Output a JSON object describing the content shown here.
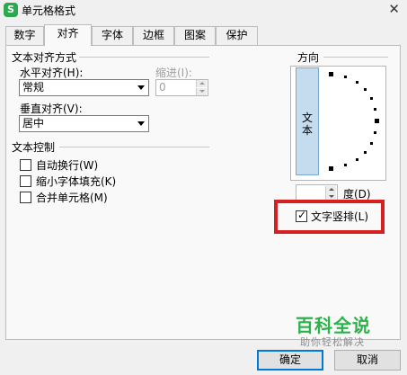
{
  "window": {
    "title": "单元格格式",
    "app_icon": "S",
    "close_label": "✕"
  },
  "tabs": [
    {
      "label": "数字"
    },
    {
      "label": "对齐",
      "active": true
    },
    {
      "label": "字体"
    },
    {
      "label": "边框"
    },
    {
      "label": "图案"
    },
    {
      "label": "保护"
    }
  ],
  "text_alignment": {
    "section_title": "文本对齐方式",
    "horizontal_label": "水平对齐(H):",
    "horizontal_value": "常规",
    "indent_label": "缩进(I):",
    "indent_value": "0",
    "vertical_label": "垂直对齐(V):",
    "vertical_value": "居中"
  },
  "text_control": {
    "section_title": "文本控制",
    "options": [
      {
        "label": "自动换行(W)",
        "checked": false
      },
      {
        "label": "缩小字体填充(K)",
        "checked": false
      },
      {
        "label": "合并单元格(M)",
        "checked": false
      }
    ]
  },
  "orientation": {
    "section_title": "方向",
    "vertical_text_button": "文本",
    "degree_value": "",
    "degree_label": "度(D)",
    "vertical_text_checkbox": {
      "label": "文字竖排(L)",
      "checked": true
    }
  },
  "watermark": {
    "main": "百科全说",
    "sub": "助你轻松解决"
  },
  "buttons": {
    "ok": "确定",
    "cancel": "取消"
  },
  "colors": {
    "highlight": "#d42020",
    "watermark": "#2bb34a",
    "accent": "#0078d7"
  }
}
